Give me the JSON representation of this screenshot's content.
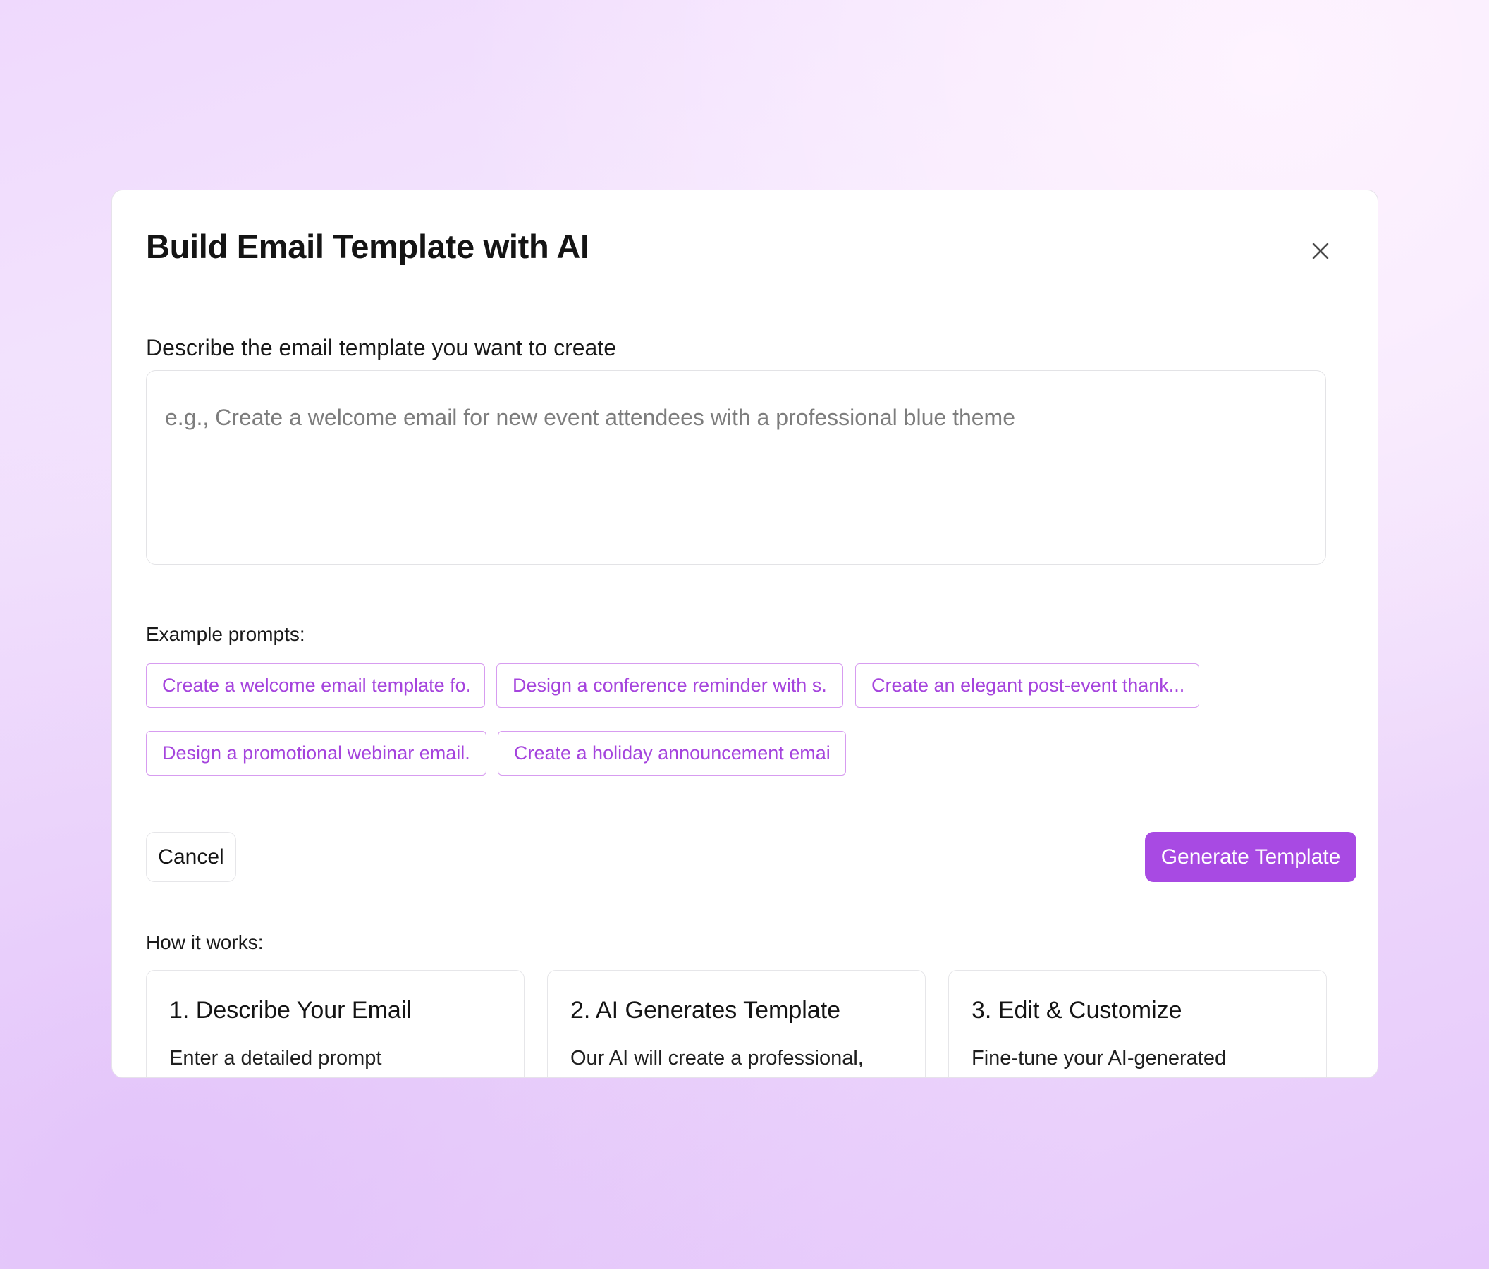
{
  "dialog": {
    "title": "Build Email Template with AI",
    "close_icon": "close-icon"
  },
  "prompt": {
    "label": "Describe the email template you want to create",
    "placeholder": "e.g., Create a welcome email for new event attendees with a professional blue theme",
    "value": ""
  },
  "examples": {
    "label": "Example prompts:",
    "items": [
      "Create a welcome email template fo...",
      "Design a conference reminder with s....",
      "Create an elegant post-event thank....",
      "Design a promotional webinar email...",
      "Create a holiday announcement email..."
    ]
  },
  "actions": {
    "cancel_label": "Cancel",
    "generate_label": "Generate Template"
  },
  "how_it_works": {
    "label": "How it works:",
    "steps": [
      {
        "title": "1. Describe Your Email",
        "description": "Enter a detailed prompt"
      },
      {
        "title": "2. AI Generates Template",
        "description": "Our AI will create a professional,"
      },
      {
        "title": "3. Edit & Customize",
        "description": "Fine-tune your AI-generated"
      }
    ]
  },
  "colors": {
    "accent": "#a84ae3",
    "chip_text": "#a544dd",
    "chip_border": "#d79cf0"
  }
}
